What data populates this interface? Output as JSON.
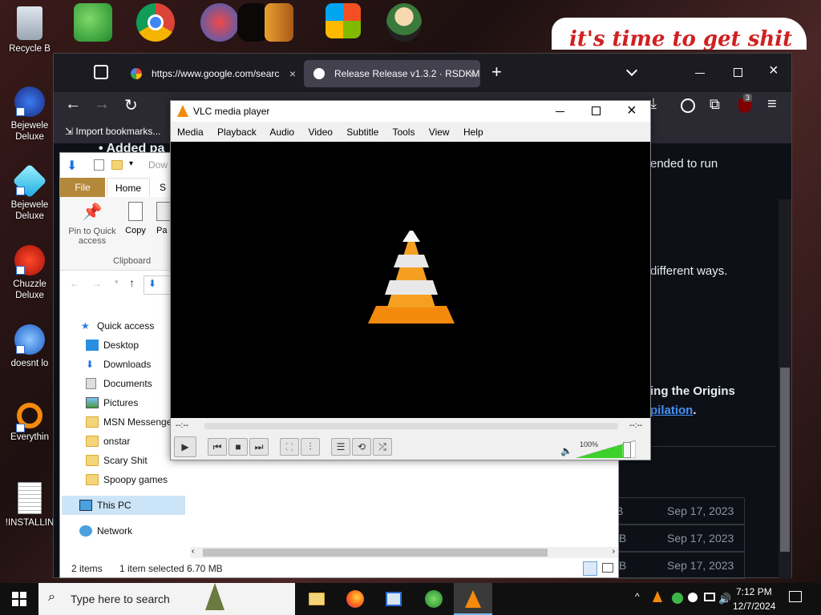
{
  "desktop": {
    "icons": [
      {
        "label": "Recycle B"
      },
      {
        "label": "Bejewele\nDeluxe"
      },
      {
        "label": "Bejewele\nDeluxe"
      },
      {
        "label": "Chuzzle\nDeluxe"
      },
      {
        "label": "doesnt lo"
      },
      {
        "label": "Everythin"
      },
      {
        "label": "!INSTALLIN"
      }
    ],
    "banner_text": "it's time to get shit"
  },
  "firefox": {
    "tab1_title": "https://www.google.com/searc",
    "tab2_title": "Release Release v1.3.2 · RSDKMo",
    "new_tab": "+",
    "bookmark_import": "Import bookmarks...",
    "addon_badge": "3",
    "content": {
      "heading_partial": "Added pa",
      "line1": "ended to run",
      "line2": "different ways.",
      "line3": "ing the Origins",
      "line4_link": "pilation",
      "line4_dot": ".",
      "assets": [
        {
          "size": "B",
          "date": "Sep 17, 2023"
        },
        {
          "size": "IB",
          "date": "Sep 17, 2023"
        },
        {
          "size": "IB",
          "date": "Sep 17, 2023"
        }
      ]
    }
  },
  "explorer": {
    "address_partial": "Dow",
    "ribbon_tabs": {
      "file": "File",
      "home": "Home",
      "share": "S"
    },
    "ribbon": {
      "pin_label": "Pin to Quick\naccess",
      "copy_label": "Copy",
      "paste_label": "Pa",
      "group_label": "Clipboard"
    },
    "nav": {
      "quick_access": "Quick access",
      "items": [
        "Desktop",
        "Downloads",
        "Documents",
        "Pictures",
        "MSN Messenger",
        "onstar",
        "Scary Shit",
        "Spoopy games"
      ],
      "this_pc": "This PC",
      "network": "Network"
    },
    "status": {
      "items": "2 items",
      "selected": "1 item selected",
      "size": "6.70 MB"
    }
  },
  "vlc": {
    "title": "VLC media player",
    "menu": [
      "Media",
      "Playback",
      "Audio",
      "Video",
      "Subtitle",
      "Tools",
      "View",
      "Help"
    ],
    "time_left": "--:--",
    "time_right": "--:--",
    "volume_label": "100%",
    "volume": 100
  },
  "taskbar": {
    "search_placeholder": "Type here to search",
    "time": "7:12 PM",
    "date": "12/7/2024"
  },
  "colors": {
    "vlc_orange": "#f48a0c",
    "github_link": "#4493f8",
    "explorer_file_tab": "#b4883a",
    "volume_green": "#3cd22a"
  }
}
